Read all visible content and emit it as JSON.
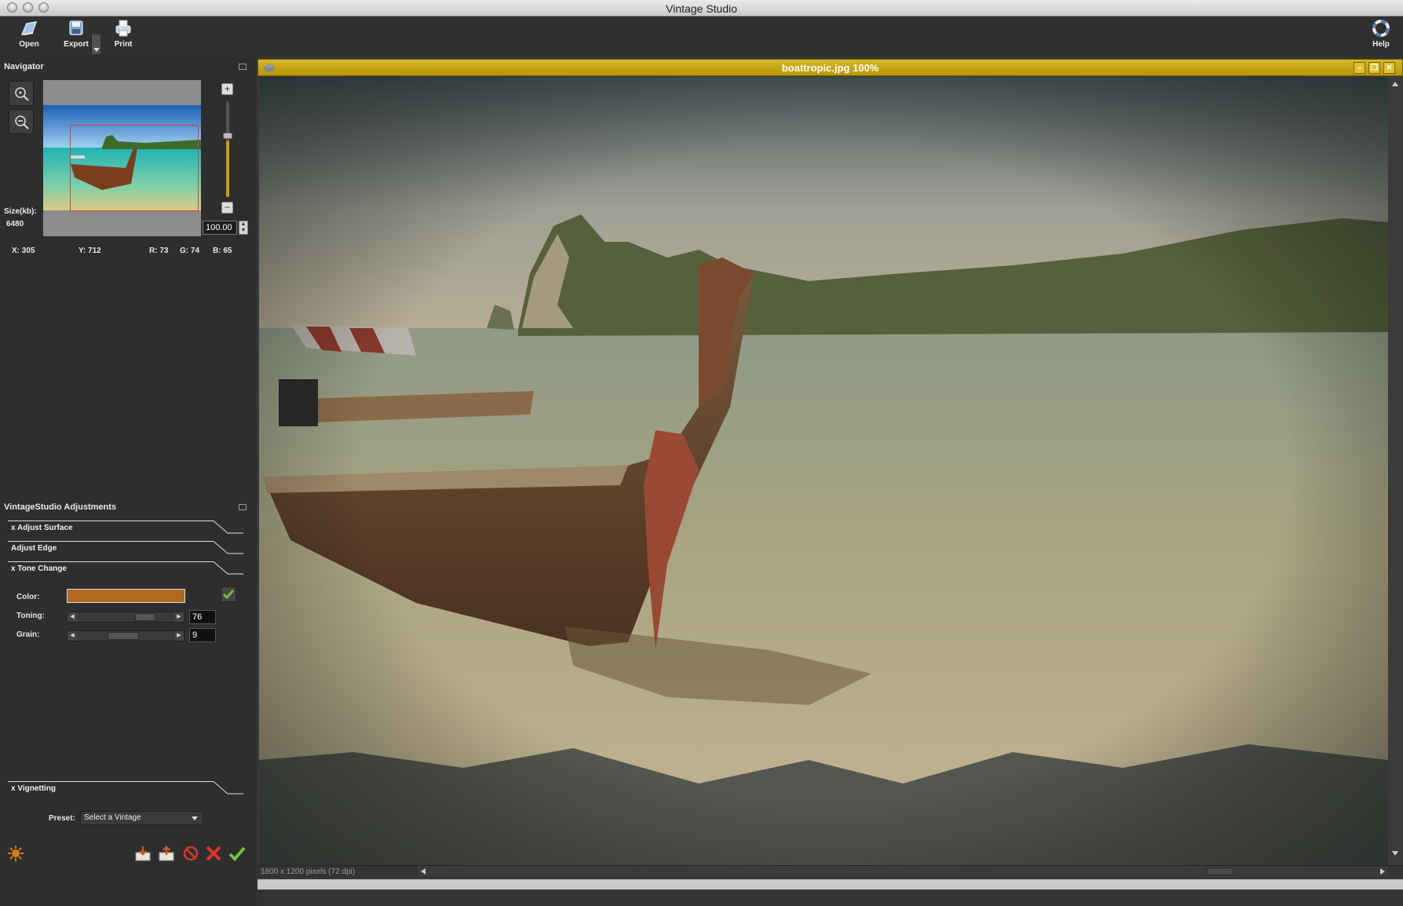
{
  "window": {
    "title": "Vintage Studio"
  },
  "toolbar": {
    "open_label": "Open",
    "export_label": "Export",
    "print_label": "Print",
    "help_label": "Help"
  },
  "navigator": {
    "title": "Navigator",
    "size_label": "Size(kb):",
    "size_value": "6480",
    "zoom_value": "100.00",
    "zoom_plus": "+",
    "zoom_minus": "−",
    "coords": {
      "x": "X: 305",
      "y": "Y: 712",
      "r": "R: 73",
      "g": "G: 74",
      "b": "B: 65"
    }
  },
  "adjustments": {
    "title": "VintageStudio Adjustments",
    "sections": {
      "surface": "x Adjust Surface",
      "edge": "Adjust Edge",
      "tone": "x Tone Change",
      "vignette": "x Vignetting"
    },
    "tone": {
      "color_label": "Color:",
      "color_value": "#b06a20",
      "toning_label": "Toning:",
      "toning_value": "76",
      "grain_label": "Grain:",
      "grain_value": "9"
    },
    "preset_label": "Preset:",
    "preset_value": "Select a Vintage"
  },
  "image_window": {
    "title": "boattropic.jpg 100%",
    "status": "1800 x 1200 pixels (72 dpi)"
  },
  "icons": [
    "open-icon",
    "export-icon",
    "print-icon",
    "help-icon",
    "zoom-fit-icon",
    "zoom-out-icon",
    "check-icon",
    "sun-icon",
    "load-preset-icon",
    "save-preset-icon",
    "reset-icon",
    "cancel-icon",
    "apply-icon"
  ],
  "colors": {
    "accent": "#c8a10a",
    "tone_color": "#b06a20"
  }
}
